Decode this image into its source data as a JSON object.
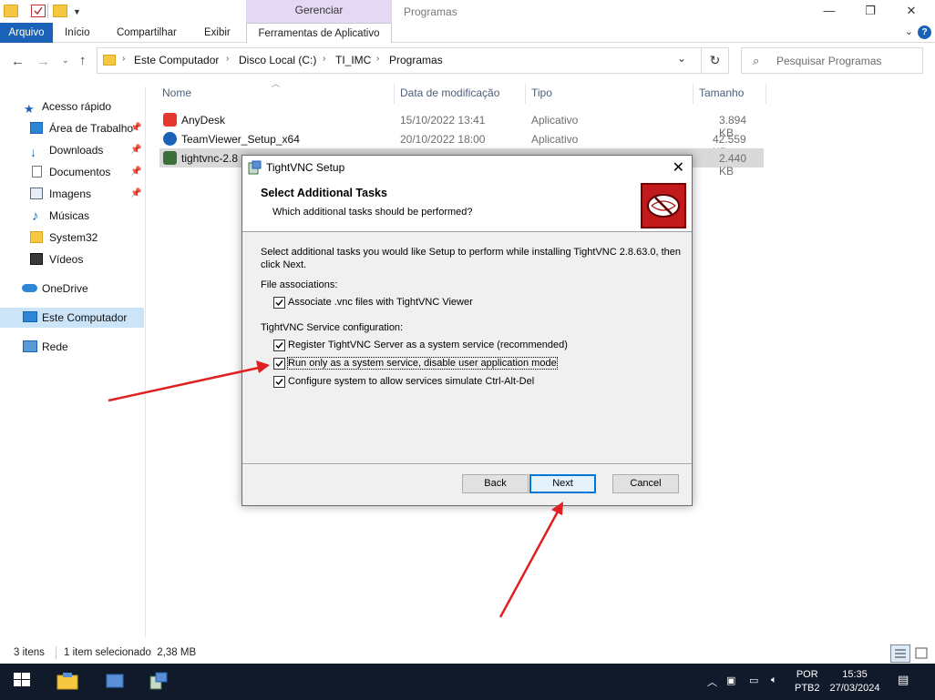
{
  "window": {
    "title": "Programas",
    "context_tab": "Gerenciar",
    "controls": {
      "minimize": "—",
      "maximize": "❐",
      "close": "✕"
    }
  },
  "ribbon": {
    "tabs": [
      "Arquivo",
      "Início",
      "Compartilhar",
      "Exibir",
      "Ferramentas de Aplicativo"
    ],
    "help": "?"
  },
  "address": {
    "breadcrumbs": [
      "Este Computador",
      "Disco Local (C:)",
      "TI_IMC",
      "Programas"
    ],
    "search_placeholder": "Pesquisar Programas"
  },
  "sidebar": {
    "items": [
      {
        "label": "Acesso rápido",
        "icon": "star-icon"
      },
      {
        "label": "Área de Trabalho",
        "icon": "desktop-icon",
        "pinned": true
      },
      {
        "label": "Downloads",
        "icon": "download-icon",
        "pinned": true
      },
      {
        "label": "Documentos",
        "icon": "document-icon",
        "pinned": true
      },
      {
        "label": "Imagens",
        "icon": "image-icon",
        "pinned": true
      },
      {
        "label": "Músicas",
        "icon": "music-icon"
      },
      {
        "label": "System32",
        "icon": "folder-icon"
      },
      {
        "label": "Vídeos",
        "icon": "video-icon"
      },
      {
        "label": "OneDrive",
        "icon": "cloud-icon"
      },
      {
        "label": "Este Computador",
        "icon": "computer-icon",
        "selected": true
      },
      {
        "label": "Rede",
        "icon": "network-icon"
      }
    ]
  },
  "file_list": {
    "columns": [
      "Nome",
      "Data de modificação",
      "Tipo",
      "Tamanho"
    ],
    "rows": [
      {
        "name": "AnyDesk",
        "date": "15/10/2022 13:41",
        "type": "Aplicativo",
        "size": "3.894 KB",
        "icon": "anydesk-icon"
      },
      {
        "name": "TeamViewer_Setup_x64",
        "date": "20/10/2022 18:00",
        "type": "Aplicativo",
        "size": "42.559 KB",
        "icon": "teamviewer-icon"
      },
      {
        "name": "tightvnc-2.8",
        "date": "",
        "type": "",
        "size": "2.440 KB",
        "icon": "installer-icon",
        "selected": true
      }
    ]
  },
  "status": {
    "count": "3 itens",
    "selection": "1 item selecionado  2,38 MB"
  },
  "dialog": {
    "title": "TightVNC Setup",
    "heading": "Select Additional Tasks",
    "subheading": "Which additional tasks should be performed?",
    "intro": "Select additional tasks you would like Setup to perform while installing TightVNC 2.8.63.0, then click Next.",
    "group1_label": "File associations:",
    "group1_items": [
      {
        "label": "Associate .vnc files with TightVNC Viewer",
        "checked": true
      }
    ],
    "group2_label": "TightVNC Service configuration:",
    "group2_items": [
      {
        "label": "Register TightVNC Server as a system service (recommended)",
        "checked": true
      },
      {
        "label": "Run only as a system service, disable user application mode",
        "checked": true,
        "focused": true
      },
      {
        "label": "Configure system to allow services simulate Ctrl-Alt-Del",
        "checked": true
      }
    ],
    "buttons": {
      "back": "Back",
      "next": "Next",
      "cancel": "Cancel"
    }
  },
  "taskbar": {
    "lang": "POR",
    "layout": "PTB2",
    "time": "15:35",
    "date": "27/03/2024"
  },
  "colors": {
    "accent": "#1a62b8",
    "arrow": "#e02020",
    "taskbar": "#101a2a",
    "selected_row": "#d9d9d9",
    "sidebar_selected": "#cce4f7"
  }
}
